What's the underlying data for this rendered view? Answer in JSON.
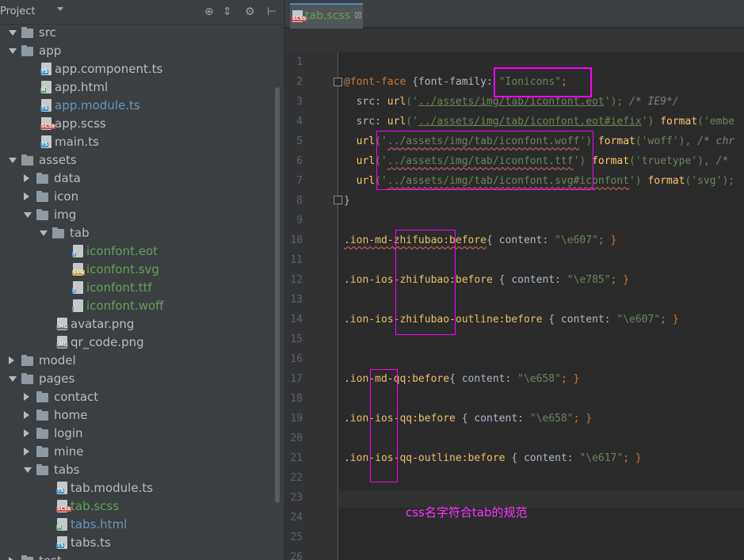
{
  "project": {
    "title": "Project",
    "tools": [
      "target-icon",
      "collapse-icon",
      "gear-icon",
      "pin-icon"
    ]
  },
  "tree": [
    {
      "label": "src",
      "depth": 0,
      "kind": "folder",
      "state": "open",
      "color": "normal"
    },
    {
      "label": "app",
      "depth": 0,
      "kind": "folder",
      "state": "open",
      "color": "normal"
    },
    {
      "label": "app.component.ts",
      "depth": 2,
      "kind": "file",
      "tag": "TS",
      "color": "normal"
    },
    {
      "label": "app.html",
      "depth": 2,
      "kind": "file",
      "tag": "H",
      "color": "normal"
    },
    {
      "label": "app.module.ts",
      "depth": 2,
      "kind": "file",
      "tag": "TS",
      "color": "modified"
    },
    {
      "label": "app.scss",
      "depth": 2,
      "kind": "file",
      "tag": "SCSS",
      "color": "normal"
    },
    {
      "label": "main.ts",
      "depth": 2,
      "kind": "file",
      "tag": "TS",
      "color": "normal"
    },
    {
      "label": "assets",
      "depth": 0,
      "kind": "folder",
      "state": "open",
      "color": "normal"
    },
    {
      "label": "data",
      "depth": 1,
      "kind": "folder",
      "state": "closed",
      "color": "normal"
    },
    {
      "label": "icon",
      "depth": 1,
      "kind": "folder",
      "state": "closed",
      "color": "normal"
    },
    {
      "label": "img",
      "depth": 1,
      "kind": "folder",
      "state": "open",
      "color": "normal"
    },
    {
      "label": "tab",
      "depth": 2,
      "kind": "folder",
      "state": "open",
      "color": "normal"
    },
    {
      "label": "iconfont.eot",
      "depth": 4,
      "kind": "file",
      "tag": "?",
      "color": "untracked"
    },
    {
      "label": "iconfont.svg",
      "depth": 4,
      "kind": "file",
      "tag": "SVG",
      "color": "untracked"
    },
    {
      "label": "iconfont.ttf",
      "depth": 4,
      "kind": "file",
      "tag": "?",
      "color": "untracked"
    },
    {
      "label": "iconfont.woff",
      "depth": 4,
      "kind": "file",
      "tag": "",
      "color": "untracked"
    },
    {
      "label": "avatar.png",
      "depth": 3,
      "kind": "file",
      "tag": "IMG",
      "color": "normal"
    },
    {
      "label": "qr_code.png",
      "depth": 3,
      "kind": "file",
      "tag": "IMG",
      "color": "normal"
    },
    {
      "label": "model",
      "depth": 0,
      "kind": "folder",
      "state": "closed",
      "color": "normal"
    },
    {
      "label": "pages",
      "depth": 0,
      "kind": "folder",
      "state": "open",
      "color": "normal"
    },
    {
      "label": "contact",
      "depth": 1,
      "kind": "folder",
      "state": "closed",
      "color": "normal"
    },
    {
      "label": "home",
      "depth": 1,
      "kind": "folder",
      "state": "closed",
      "color": "normal"
    },
    {
      "label": "login",
      "depth": 1,
      "kind": "folder",
      "state": "closed",
      "color": "normal"
    },
    {
      "label": "mine",
      "depth": 1,
      "kind": "folder",
      "state": "closed",
      "color": "normal"
    },
    {
      "label": "tabs",
      "depth": 1,
      "kind": "folder",
      "state": "open",
      "color": "normal"
    },
    {
      "label": "tab.module.ts",
      "depth": 3,
      "kind": "file",
      "tag": "TS",
      "color": "normal"
    },
    {
      "label": "tab.scss",
      "depth": 3,
      "kind": "file",
      "tag": "SCSS",
      "color": "untracked"
    },
    {
      "label": "tabs.html",
      "depth": 3,
      "kind": "file",
      "tag": "H",
      "color": "modified"
    },
    {
      "label": "tabs.ts",
      "depth": 3,
      "kind": "file",
      "tag": "TS",
      "color": "normal"
    },
    {
      "label": "test",
      "depth": 0,
      "kind": "folder",
      "state": "closed",
      "color": "normal"
    }
  ],
  "editor": {
    "tab_label": "tab.scss",
    "tab_icon_tag": "SCSS",
    "close_glyph": "⊠",
    "line_numbers": [
      "1",
      "2",
      "3",
      "4",
      "5",
      "6",
      "7",
      "8",
      "9",
      "10",
      "11",
      "12",
      "13",
      "14",
      "15",
      "16",
      "17",
      "18",
      "19",
      "20",
      "21",
      "22",
      "23",
      "24",
      "25",
      "26"
    ],
    "lines": {
      "l2a": "@font-face",
      "l2b": " {font-family: ",
      "l2c": "\"Ionicons\"",
      "l2d": ";",
      "l3a": "  src: ",
      "l3b": "url",
      "l3c": "('",
      "l3d": "../assets/img/tab/iconfont.eot",
      "l3e": "'); ",
      "l3f": "/* IE9*/",
      "l4a": "  src: ",
      "l4b": "url",
      "l4c": "('",
      "l4d": "../assets/img/tab/iconfont.eot#iefix",
      "l4e": "') ",
      "l4f": "format",
      "l4g": "('embe",
      "l5a": "  url",
      "l5b": "('",
      "l5c": "../assets/img/tab/iconfont.woff",
      "l5d": "') ",
      "l5e": "format",
      "l5f": "('woff'), ",
      "l5g": "/* chr",
      "l6a": "  url",
      "l6b": "('",
      "l6c": "../assets/img/tab/iconfont.ttf",
      "l6d": "') ",
      "l6e": "format",
      "l6f": "('truetype'), ",
      "l6g": "/*",
      "l7a": "  url",
      "l7b": "('",
      "l7c": "../assets/img/tab/iconfont.svg#iconfont",
      "l7d": "') ",
      "l7e": "format",
      "l7f": "('svg');",
      "l8": "}",
      "l10a": ".ion-md-zhifubao:before",
      "l10b": "{ content: ",
      "l10c": "\"\\e607\"",
      "l10d": "; }",
      "l12a": ".ion-ios-zhifubao:before",
      "l12b": " { content: ",
      "l12c": "\"\\e785\"",
      "l12d": "; }",
      "l14a": ".ion-ios-zhifubao-outline:before",
      "l14b": " { content: ",
      "l14c": "\"\\e607\"",
      "l14d": "; }",
      "l17a": ".ion-md-qq:before",
      "l17b": "{ content: ",
      "l17c": "\"\\e658\"",
      "l17d": "; }",
      "l19a": ".ion-ios-qq:before",
      "l19b": " { content: ",
      "l19c": "\"\\e658\"",
      "l19d": "; }",
      "l21a": ".ion-ios-qq-outline:before",
      "l21b": " { content: ",
      "l21c": "\"\\e617\"",
      "l21d": "; }"
    },
    "annotation": "css名字符合tab的规范"
  },
  "colors": {
    "highlight_box": "#ff00ff",
    "annotation": "#ff33ff",
    "modified": "#6897bb",
    "untracked": "#62a35c"
  }
}
